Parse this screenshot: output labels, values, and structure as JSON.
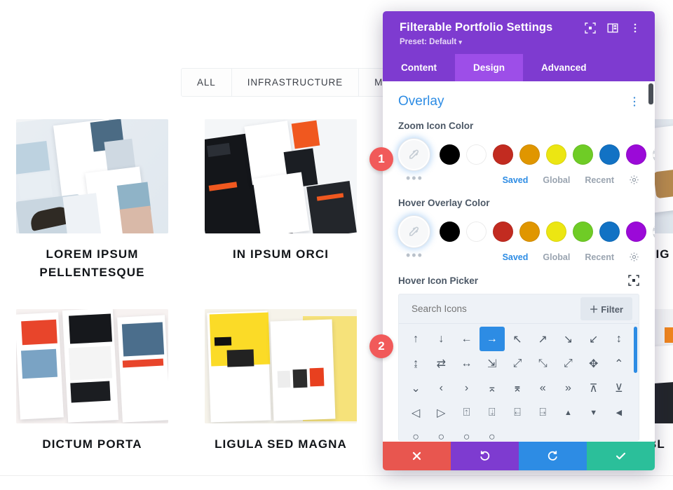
{
  "site": {
    "filters": [
      {
        "label": "ALL"
      },
      {
        "label": "INFRASTRUCTURE"
      },
      {
        "label": "MOBILE"
      }
    ],
    "portfolio": [
      {
        "title": "LOREM IPSUM PELLENTESQUE"
      },
      {
        "title": "IN IPSUM ORCI"
      },
      {
        "title": "LIG"
      },
      {
        "title": "DICTUM PORTA"
      },
      {
        "title": "LIGULA SED MAGNA"
      },
      {
        "title": "BL"
      }
    ]
  },
  "modal": {
    "title": "Filterable Portfolio Settings",
    "preset_label": "Preset: Default",
    "preset_caret": "▾",
    "header_icons": [
      {
        "name": "fullscreen-icon"
      },
      {
        "name": "layout-columns-icon"
      },
      {
        "name": "vertical-dots-icon"
      }
    ],
    "tabs": [
      {
        "label": "Content",
        "active": false
      },
      {
        "label": "Design",
        "active": true
      },
      {
        "label": "Advanced",
        "active": false
      }
    ],
    "section": {
      "title": "Overlay",
      "options_icon": "vertical-dots-icon"
    },
    "fields": {
      "zoom_icon_color": {
        "label": "Zoom Icon Color",
        "picker_icon": "eyedropper-icon",
        "more_dots": "•••",
        "swatches": [
          {
            "name": "black",
            "hex": "#000000"
          },
          {
            "name": "white",
            "hex": "#ffffff"
          },
          {
            "name": "red",
            "hex": "#c22b20"
          },
          {
            "name": "orange",
            "hex": "#e09600"
          },
          {
            "name": "yellow",
            "hex": "#ece612"
          },
          {
            "name": "green",
            "hex": "#6fcc26"
          },
          {
            "name": "blue",
            "hex": "#1272c4"
          },
          {
            "name": "purple",
            "hex": "#9b0ad8"
          },
          {
            "name": "transparent",
            "hex": "none"
          }
        ],
        "meta": [
          {
            "label": "Saved",
            "active": true
          },
          {
            "label": "Global",
            "active": false
          },
          {
            "label": "Recent",
            "active": false
          }
        ],
        "settings_icon": "gear-icon"
      },
      "hover_overlay_color": {
        "label": "Hover Overlay Color",
        "picker_icon": "eyedropper-icon",
        "more_dots": "•••",
        "swatches": [
          {
            "name": "black",
            "hex": "#000000"
          },
          {
            "name": "white",
            "hex": "#ffffff"
          },
          {
            "name": "red",
            "hex": "#c22b20"
          },
          {
            "name": "orange",
            "hex": "#e09600"
          },
          {
            "name": "yellow",
            "hex": "#ece612"
          },
          {
            "name": "green",
            "hex": "#6fcc26"
          },
          {
            "name": "blue",
            "hex": "#1272c4"
          },
          {
            "name": "purple",
            "hex": "#9b0ad8"
          },
          {
            "name": "transparent",
            "hex": "none"
          }
        ],
        "meta": [
          {
            "label": "Saved",
            "active": true
          },
          {
            "label": "Global",
            "active": false
          },
          {
            "label": "Recent",
            "active": false
          }
        ],
        "settings_icon": "gear-icon"
      },
      "hover_icon_picker": {
        "label": "Hover Icon Picker",
        "expand_icon": "fullscreen-icon",
        "search_placeholder": "Search Icons",
        "search_value": "",
        "filter_button": "＋ Filter",
        "selected_icon": "arrow-right",
        "icons": [
          "↑",
          "↓",
          "←",
          "→",
          "↖",
          "↗",
          "↘",
          "↙",
          "↕",
          "⇕",
          "⇌",
          "↔",
          "⇲",
          "⤢",
          "⤡",
          "⤢",
          "✥",
          "⌃",
          "⌄",
          "‹",
          "›",
          "⌃⌃",
          "⌄⌄",
          "«",
          "»",
          "⌃○",
          "⌄○",
          "‹○",
          "›○",
          "⌃⌃○",
          "⌄⌄○",
          "«○",
          "»○",
          "▲",
          "▼",
          "◀"
        ]
      }
    },
    "footer_buttons": [
      {
        "name": "cancel-button",
        "icon": "close-icon",
        "color": "#e8564f"
      },
      {
        "name": "undo-button",
        "icon": "undo-icon",
        "color": "#7E3BD0"
      },
      {
        "name": "redo-button",
        "icon": "redo-icon",
        "color": "#2d8ce4"
      },
      {
        "name": "save-button",
        "icon": "check-icon",
        "color": "#2bbf9a"
      }
    ]
  },
  "callouts": [
    {
      "number": "1"
    },
    {
      "number": "2"
    }
  ]
}
